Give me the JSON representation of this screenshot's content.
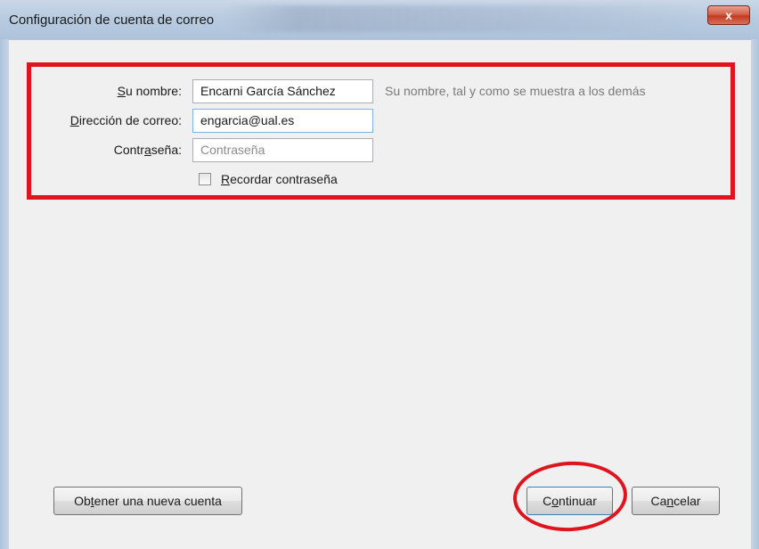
{
  "window": {
    "title": "Configuración de cuenta de correo",
    "close_glyph": "x"
  },
  "form": {
    "name_label": {
      "pre": "",
      "key": "S",
      "post": "u nombre:"
    },
    "name_value": "Encarni García Sánchez",
    "name_hint": "Su nombre, tal y como se muestra a los demás",
    "email_label": {
      "pre": "",
      "key": "D",
      "post": "irección de correo:"
    },
    "email_value": "engarcia@ual.es",
    "password_label": {
      "pre": "Contr",
      "key": "a",
      "post": "seña:"
    },
    "password_placeholder": "Contraseña",
    "remember_label": {
      "pre": "",
      "key": "R",
      "post": "ecordar contraseña"
    },
    "remember_checked": false
  },
  "buttons": {
    "new_account": {
      "pre": "Ob",
      "key": "t",
      "post": "ener una nueva cuenta"
    },
    "continue": {
      "pre": "C",
      "key": "o",
      "post": "ntinuar"
    },
    "cancel": {
      "pre": "Ca",
      "key": "n",
      "post": "celar"
    }
  },
  "colors": {
    "annotation_red": "#e0141e",
    "close_button": "#c23a22"
  }
}
